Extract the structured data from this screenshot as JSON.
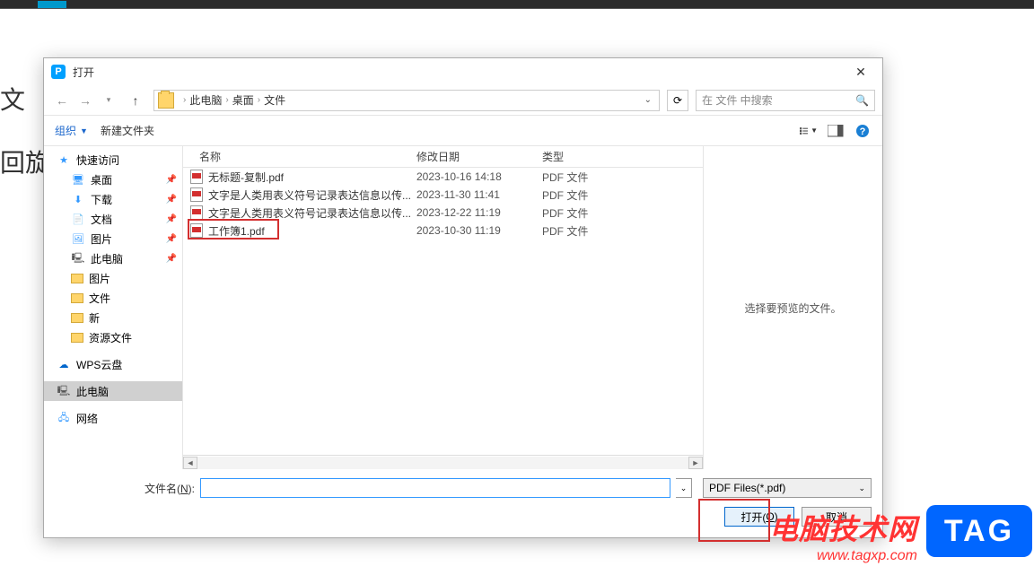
{
  "background": {
    "partial1": "文",
    "partial2": "回旋"
  },
  "dialog": {
    "title": "打开",
    "breadcrumb": {
      "pc": "此电脑",
      "desktop": "桌面",
      "folder": "文件"
    },
    "search_placeholder": "在 文件 中搜索",
    "toolbar": {
      "organize": "组织",
      "new_folder": "新建文件夹"
    },
    "sidebar": {
      "quick_access": "快速访问",
      "desktop": "桌面",
      "downloads": "下载",
      "documents": "文档",
      "pictures": "图片",
      "this_pc": "此电脑",
      "pictures2": "图片",
      "files": "文件",
      "new_folder": "新",
      "resources": "资源文件",
      "wps_cloud": "WPS云盘",
      "this_pc2": "此电脑",
      "network": "网络"
    },
    "columns": {
      "name": "名称",
      "date": "修改日期",
      "type": "类型"
    },
    "files": [
      {
        "name": "无标题-复制.pdf",
        "date": "2023-10-16 14:18",
        "type": "PDF 文件"
      },
      {
        "name": "文字是人类用表义符号记录表达信息以传...",
        "date": "2023-11-30 11:41",
        "type": "PDF 文件"
      },
      {
        "name": "文字是人类用表义符号记录表达信息以传...",
        "date": "2023-12-22 11:19",
        "type": "PDF 文件"
      },
      {
        "name": "工作簿1.pdf",
        "date": "2023-10-30 11:19",
        "type": "PDF 文件"
      }
    ],
    "preview_text": "选择要预览的文件。",
    "filename_label": "文件名(N):",
    "filename_value": "",
    "filetype": "PDF Files(*.pdf)",
    "open_btn": "打开(O)",
    "cancel_btn": "取消"
  },
  "watermark": {
    "title": "电脑技术网",
    "url": "www.tagxp.com",
    "badge": "TAG"
  }
}
